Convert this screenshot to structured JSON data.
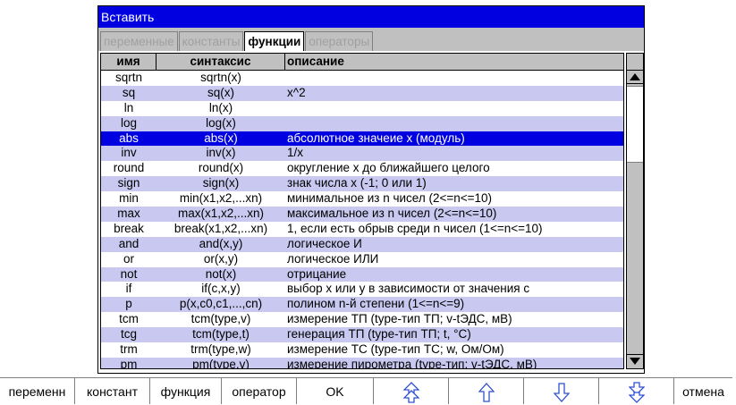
{
  "dialog": {
    "title": "Вставить"
  },
  "tabs": [
    {
      "label": "переменные",
      "active": false
    },
    {
      "label": "константы",
      "active": false
    },
    {
      "label": "функции",
      "active": true
    },
    {
      "label": "операторы",
      "active": false
    }
  ],
  "table": {
    "columns": [
      "имя",
      "синтаксис",
      "описание"
    ],
    "selected_index": 4,
    "rows": [
      {
        "name": "sqrtn",
        "syntax": "sqrtn(x)",
        "desc": ""
      },
      {
        "name": "sq",
        "syntax": "sq(x)",
        "desc": "x^2"
      },
      {
        "name": "ln",
        "syntax": "ln(x)",
        "desc": ""
      },
      {
        "name": "log",
        "syntax": "log(x)",
        "desc": ""
      },
      {
        "name": "abs",
        "syntax": "abs(x)",
        "desc": "абсолютное значеие x (модуль)"
      },
      {
        "name": "inv",
        "syntax": "inv(x)",
        "desc": "1/x"
      },
      {
        "name": "round",
        "syntax": "round(x)",
        "desc": "округление x до ближайшего целого"
      },
      {
        "name": "sign",
        "syntax": "sign(x)",
        "desc": "знак числа x (-1; 0 или 1)"
      },
      {
        "name": "min",
        "syntax": "min(x1,x2,...xn)",
        "desc": "минимальное из n чисел (2<=n<=10)"
      },
      {
        "name": "max",
        "syntax": "max(x1,x2,...xn)",
        "desc": "максимальное из n чисел (2<=n<=10)"
      },
      {
        "name": "break",
        "syntax": "break(x1,x2,...xn)",
        "desc": "1, если есть обрыв среди n чисел (1<=n<=10)"
      },
      {
        "name": "and",
        "syntax": "and(x,y)",
        "desc": "логическое И"
      },
      {
        "name": "or",
        "syntax": "or(x,y)",
        "desc": "логическое ИЛИ"
      },
      {
        "name": "not",
        "syntax": "not(x)",
        "desc": "отрицание"
      },
      {
        "name": "if",
        "syntax": "if(c,x,y)",
        "desc": "выбор x или y в зависимости от значения c"
      },
      {
        "name": "p",
        "syntax": "p(x,c0,c1,...,cn)",
        "desc": "полином n-й степени (1<=n<=9)"
      },
      {
        "name": "tcm",
        "syntax": "tcm(type,v)",
        "desc": "измерение ТП (type-тип ТП; v-tЭДС, мВ)"
      },
      {
        "name": "tcg",
        "syntax": "tcm(type,t)",
        "desc": "генерация ТП (type-тип ТП; t, °C)"
      },
      {
        "name": "trm",
        "syntax": "trm(type,w)",
        "desc": "измерение ТС (type-тип ТС; w, Ом/Ом)"
      },
      {
        "name": "pm",
        "syntax": "pm(type,v)",
        "desc": "измерение пирометра (type-тип; v-tЭДС, мВ)"
      }
    ]
  },
  "bottombar": {
    "variables": "переменн",
    "constants": "констант",
    "function": "функция",
    "operator": "оператор",
    "ok": "OK",
    "cancel": "отмена"
  },
  "colors": {
    "title_bg": "#0000e0",
    "selection_bg": "#0000e0",
    "alt_row_bg": "#c8c8f0",
    "chrome_gray": "#c0c0c0"
  },
  "icons": {
    "page_up": "double-up-arrow-icon",
    "line_up": "up-arrow-icon",
    "line_down": "down-arrow-icon",
    "page_down": "double-down-arrow-icon"
  }
}
